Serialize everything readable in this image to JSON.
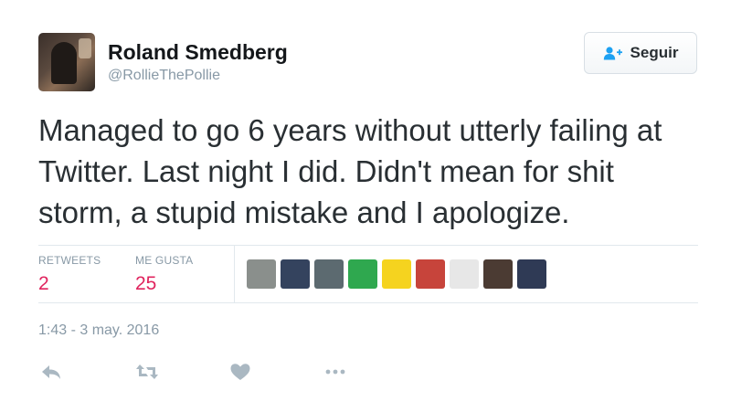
{
  "author": {
    "name": "Roland Smedberg",
    "handle": "@RollieThePollie"
  },
  "follow_button": {
    "label": "Seguir"
  },
  "tweet": {
    "text": "Managed to go 6 years without utterly failing at Twitter. Last night I did. Didn't mean for shit storm, a stupid mistake and I apologize."
  },
  "stats": {
    "retweets_label": "RETWEETS",
    "retweets_value": "2",
    "likes_label": "ME GUSTA",
    "likes_value": "25"
  },
  "likers": [
    {
      "color": "#8a8f8c"
    },
    {
      "color": "#34435e"
    },
    {
      "color": "#5c6a70"
    },
    {
      "color": "#2fa84f"
    },
    {
      "color": "#f5d31f"
    },
    {
      "color": "#c7443b"
    },
    {
      "color": "#e7e7e7"
    },
    {
      "color": "#4b3b33"
    },
    {
      "color": "#2f3a55"
    }
  ],
  "timestamp": "1:43 - 3 may. 2016",
  "actions": [
    "reply-icon",
    "retweet-icon",
    "like-icon",
    "more-icon"
  ],
  "colors": {
    "accent": "#e0245e",
    "text": "#292f33",
    "muted": "#8899a6",
    "follow_icon": "#1da1f2"
  }
}
